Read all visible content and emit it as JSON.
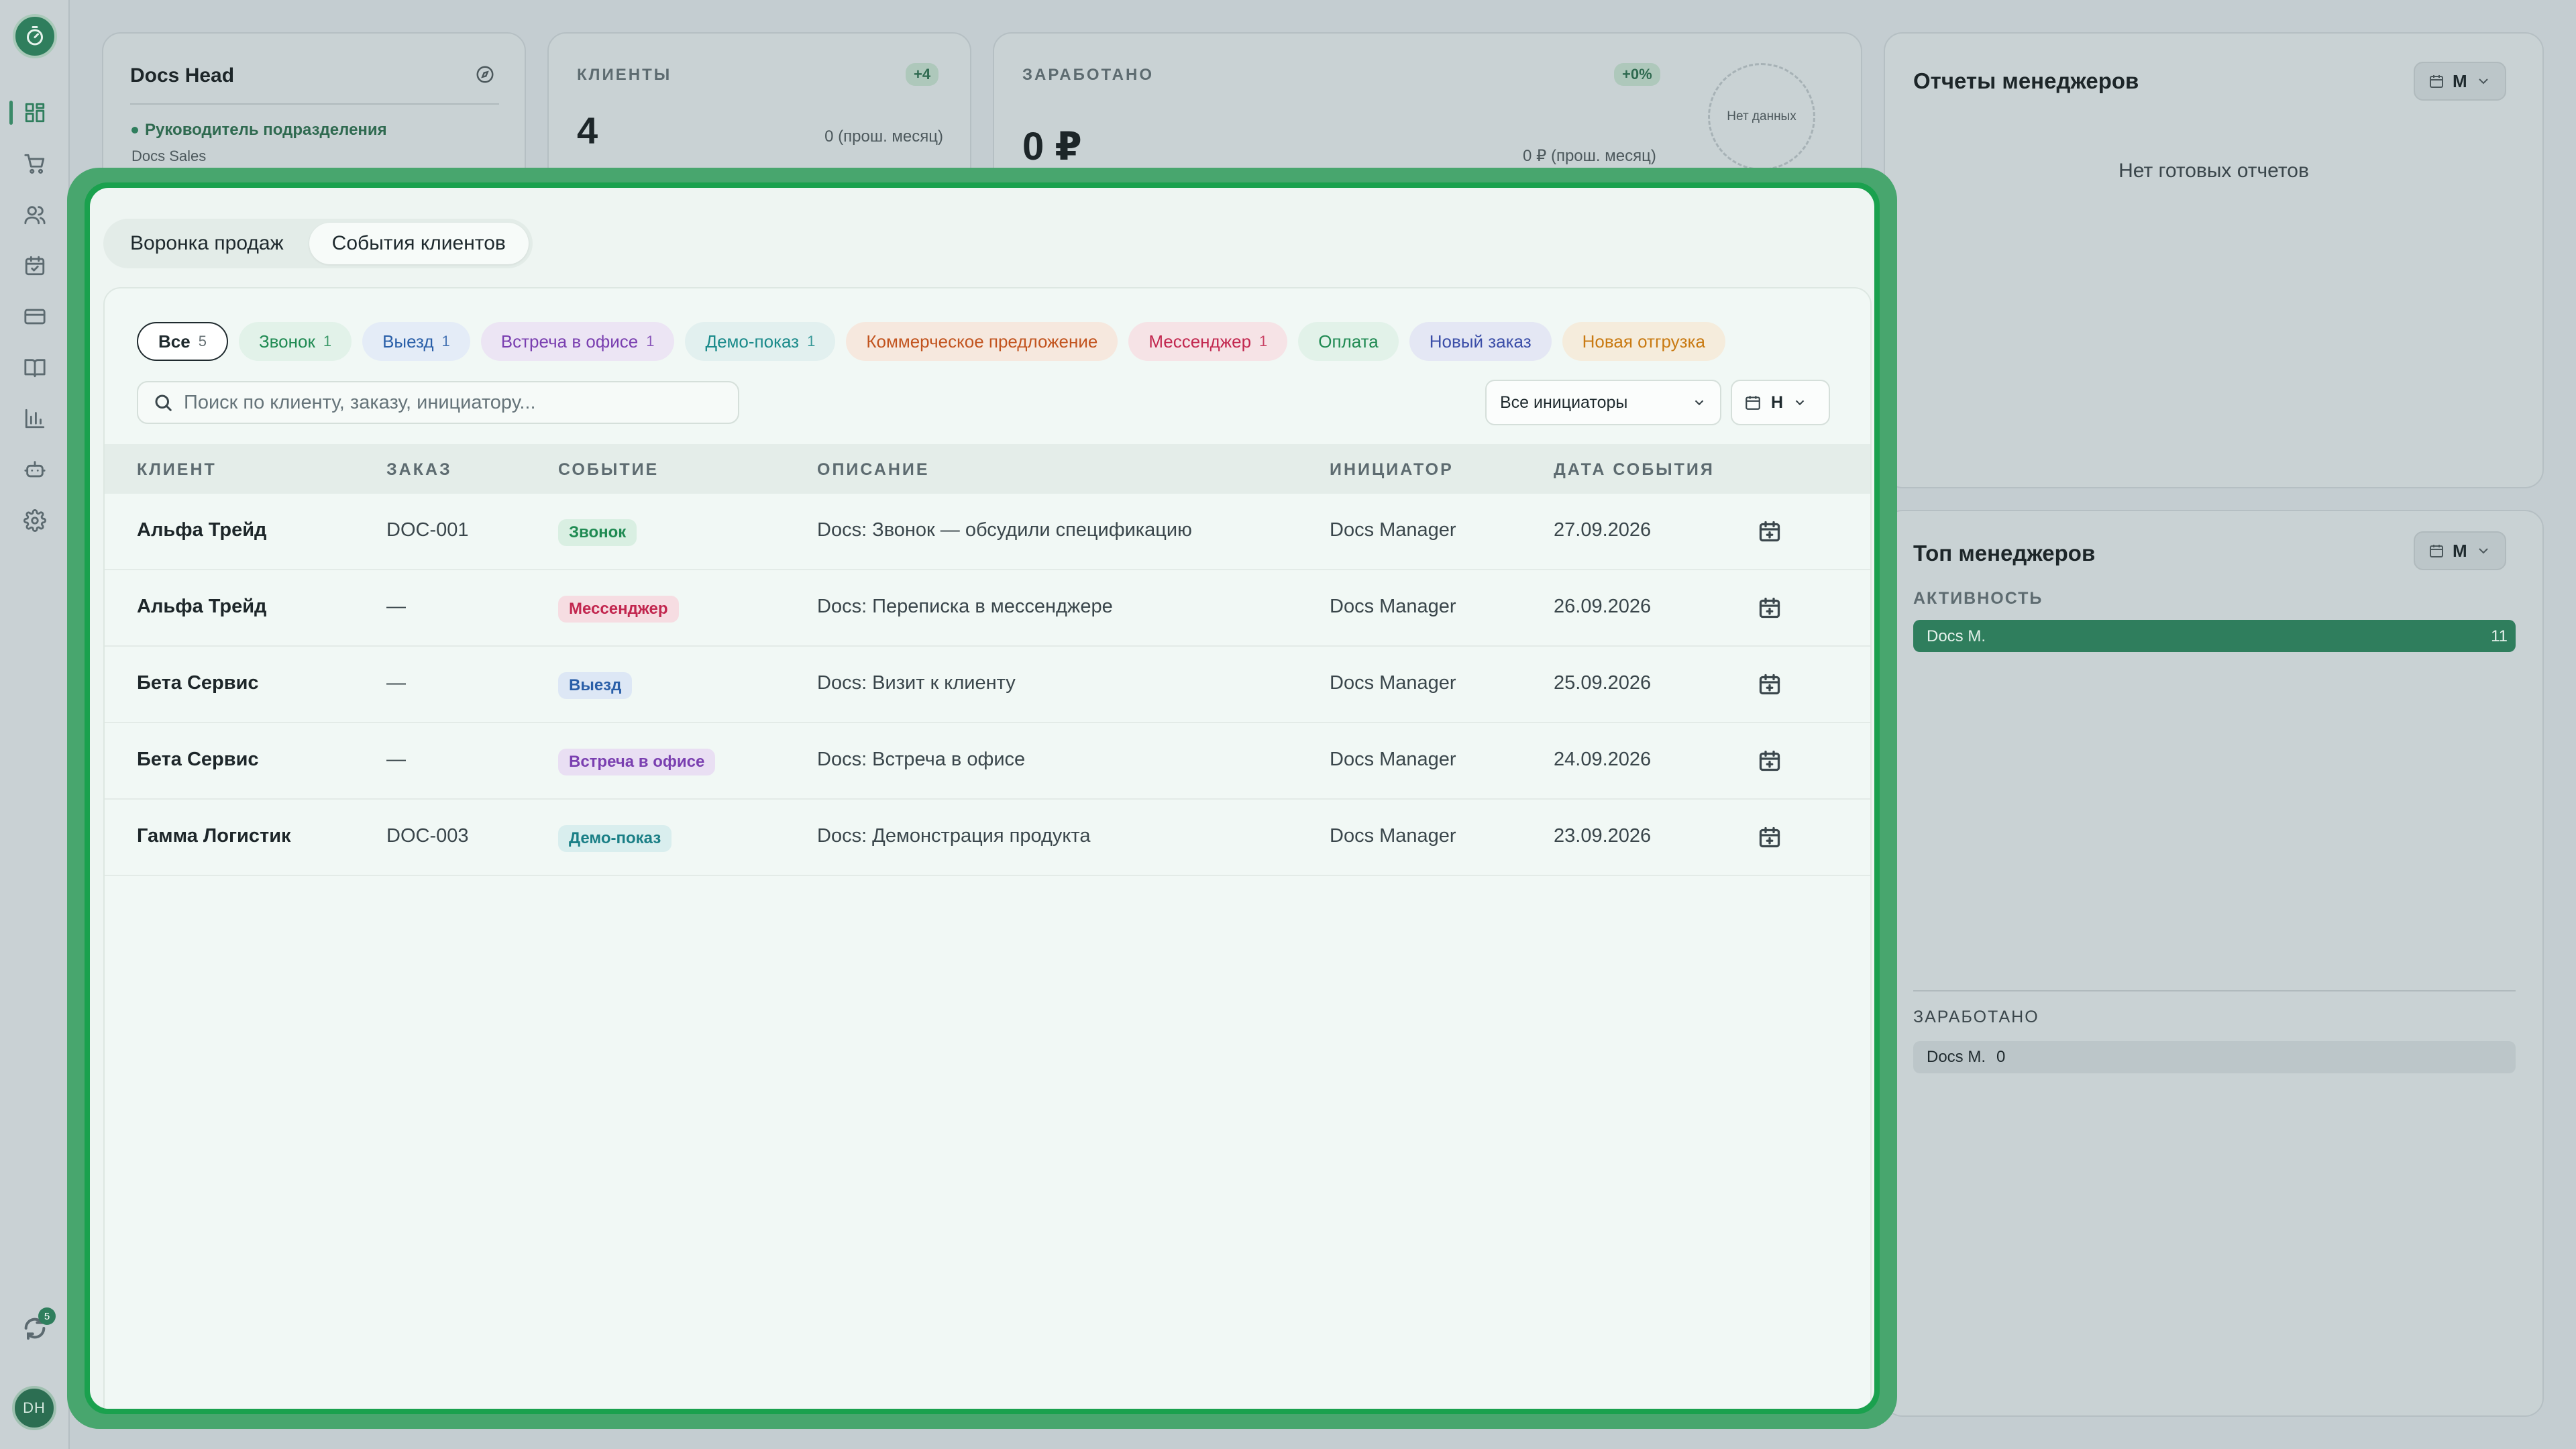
{
  "sidebar": {
    "nav": [
      "dashboard",
      "cart",
      "users",
      "calendar",
      "payments",
      "book",
      "analytics",
      "bot",
      "settings"
    ],
    "sync_badge": "5",
    "avatar_initials": "DH"
  },
  "profile_card": {
    "title": "Docs Head",
    "role": "Руководитель подразделения",
    "team": "Docs Sales"
  },
  "clients_card": {
    "caption": "КЛИЕНТЫ",
    "delta": "+4",
    "value": "4",
    "previous": "0 (прош. месяц)"
  },
  "earned_card": {
    "caption": "ЗАРАБОТАНО",
    "delta": "+0%",
    "value": "0 ₽",
    "previous": "0 ₽ (прош. месяц)",
    "chart_empty": "Нет данных"
  },
  "reports_card": {
    "title": "Отчеты менеджеров",
    "period": "М",
    "empty": "Нет готовых отчетов"
  },
  "top_card": {
    "title": "Топ менеджеров",
    "period": "М",
    "activity_caption": "АКТИВНОСТЬ",
    "activity": [
      {
        "name": "Docs M.",
        "value": "11",
        "fraction": 1.0
      }
    ],
    "earned_caption": "ЗАРАБОТАНО",
    "earned": [
      {
        "name": "Docs M.",
        "value": "0"
      }
    ]
  },
  "tabs": {
    "funnel": "Воронка продаж",
    "events": "События клиентов"
  },
  "filters": [
    {
      "label": "Все",
      "count": "5",
      "color": "#1f2a2e",
      "bg": "#ffffff"
    },
    {
      "label": "Звонок",
      "count": "1",
      "color": "#1f8a52",
      "bg": "#e2f2e9"
    },
    {
      "label": "Выезд",
      "count": "1",
      "color": "#2a5fa8",
      "bg": "#e4ecf7"
    },
    {
      "label": "Встреча в офисе",
      "count": "1",
      "color": "#7a3fb0",
      "bg": "#ece5f4"
    },
    {
      "label": "Демо-показ",
      "count": "1",
      "color": "#1a8a8a",
      "bg": "#e2f0ef"
    },
    {
      "label": "Коммерческое предложение",
      "count": "",
      "color": "#c2541f",
      "bg": "#f6e8de"
    },
    {
      "label": "Мессенджер",
      "count": "1",
      "color": "#c2274f",
      "bg": "#f6e3e6"
    },
    {
      "label": "Оплата",
      "count": "",
      "color": "#1f8a52",
      "bg": "#e2f2e9"
    },
    {
      "label": "Новый заказ",
      "count": "",
      "color": "#3b4ea8",
      "bg": "#e4e7f4"
    },
    {
      "label": "Новая отгрузка",
      "count": "",
      "color": "#c97a12",
      "bg": "#f5ecdc"
    }
  ],
  "search": {
    "placeholder": "Поиск по клиенту, заказу, инициатору..."
  },
  "initiator_filter": "Все инициаторы",
  "date_filter": "Н",
  "table": {
    "headers": [
      "КЛИЕНТ",
      "ЗАКАЗ",
      "СОБЫТИЕ",
      "ОПИСАНИЕ",
      "ИНИЦИАТОР",
      "ДАТА СОБЫТИЯ"
    ],
    "rows": [
      {
        "client": "Альфа Трейд",
        "order": "DOC-001",
        "event": "Звонок",
        "event_color": "#1f8a52",
        "event_bg": "#d9efe2",
        "description": "Docs: Звонок — обсудили спецификацию",
        "initiator": "Docs Manager",
        "date": "27.09.2026"
      },
      {
        "client": "Альфа Трейд",
        "order": "—",
        "event": "Мессенджер",
        "event_color": "#c2274f",
        "event_bg": "#f6dde2",
        "description": "Docs: Переписка в мессенджере",
        "initiator": "Docs Manager",
        "date": "26.09.2026"
      },
      {
        "client": "Бета Сервис",
        "order": "—",
        "event": "Выезд",
        "event_color": "#2a5fa8",
        "event_bg": "#dde7f5",
        "description": "Docs: Визит к клиенту",
        "initiator": "Docs Manager",
        "date": "25.09.2026"
      },
      {
        "client": "Бета Сервис",
        "order": "—",
        "event": "Встреча в офисе",
        "event_color": "#7a3fb0",
        "event_bg": "#e9dff3",
        "description": "Docs: Встреча в офисе",
        "initiator": "Docs Manager",
        "date": "24.09.2026"
      },
      {
        "client": "Гамма Логистик",
        "order": "DOC-003",
        "event": "Демо-показ",
        "event_color": "#1a7f86",
        "event_bg": "#d9eeee",
        "description": "Docs: Демонстрация продукта",
        "initiator": "Docs Manager",
        "date": "23.09.2026"
      }
    ]
  }
}
